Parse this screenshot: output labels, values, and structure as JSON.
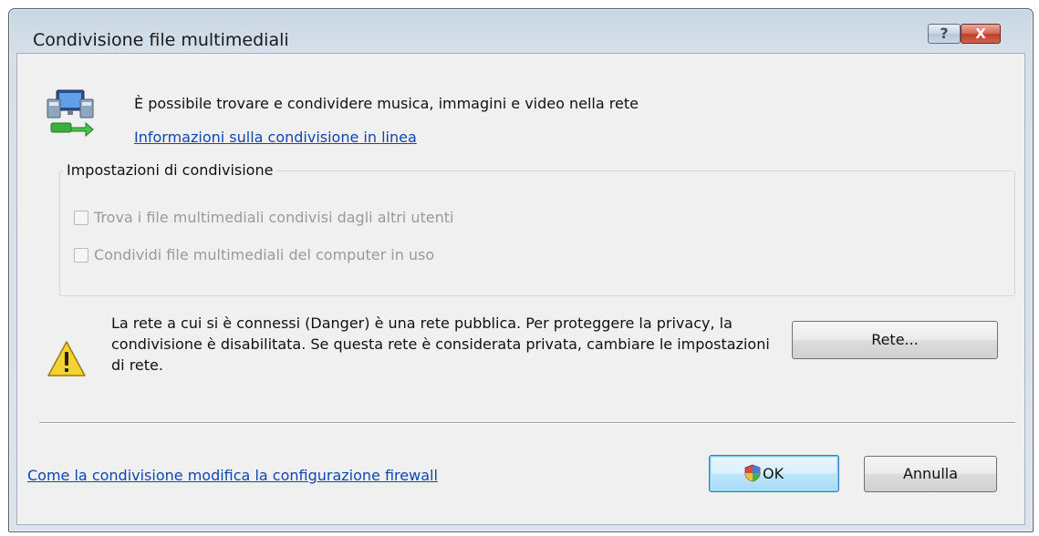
{
  "window": {
    "title": "Condivisione file multimediali",
    "help_label": "?",
    "close_label": "X"
  },
  "header": {
    "description": "È possibile trovare e condividere musica, immagini e video nella rete",
    "info_link": "Informazioni sulla condivisione in linea"
  },
  "settings": {
    "group_label": "Impostazioni di condivisione",
    "options": [
      {
        "label": "Trova i file multimediali condivisi dagli altri utenti",
        "checked": false,
        "enabled": false
      },
      {
        "label": "Condividi file multimediali del computer in uso",
        "checked": false,
        "enabled": false
      }
    ]
  },
  "warning": {
    "text": "La rete a cui si è connessi (Danger) è una rete pubblica. Per proteggere la privacy, la condivisione è disabilitata. Se questa rete è considerata privata, cambiare le impostazioni di rete.",
    "network_button": "Rete..."
  },
  "footer": {
    "firewall_link": "Come la condivisione modifica la configurazione firewall",
    "ok_label": "OK",
    "cancel_label": "Annulla"
  },
  "icons": {
    "network": "network-sharing-icon",
    "warning": "warning-icon",
    "shield": "uac-shield-icon",
    "help": "help-icon",
    "close": "close-icon"
  },
  "colors": {
    "link": "#0d47b3",
    "disabled_text": "#9a9a9a",
    "close_button": "#c0412c",
    "default_button_border": "#3c7fb1"
  }
}
